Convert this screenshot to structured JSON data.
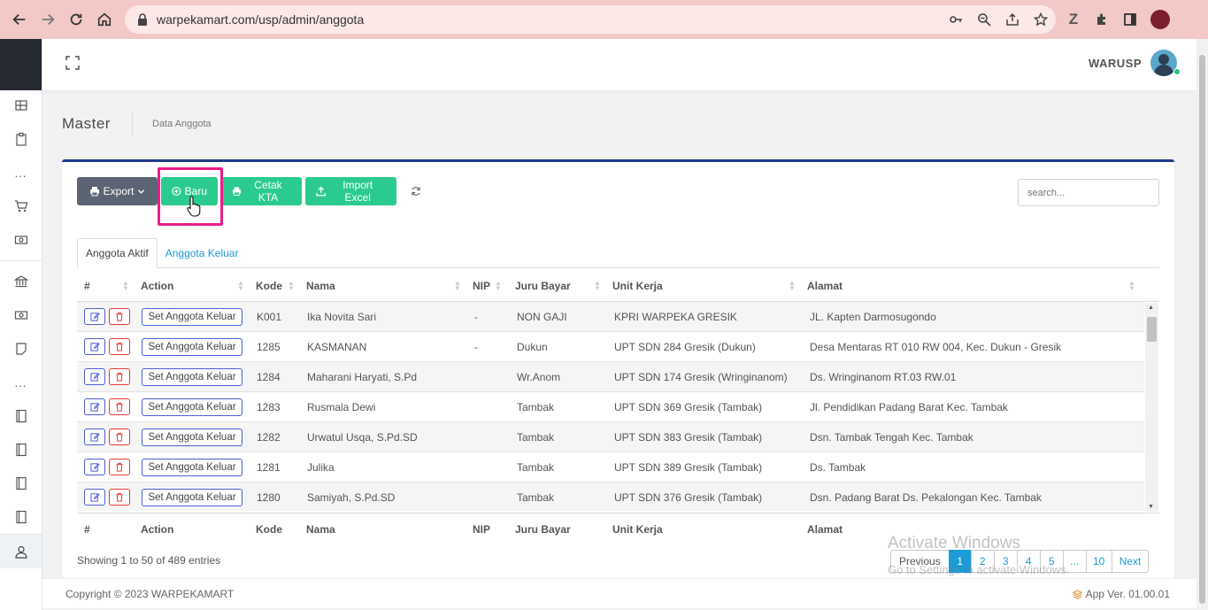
{
  "browser": {
    "url": "warpekamart.com/usp/admin/anggota"
  },
  "topbar": {
    "user_name": "WARUSP"
  },
  "breadcrumb": {
    "title": "Master",
    "current": "Data Anggota"
  },
  "toolbar": {
    "export_label": "Export",
    "baru_label": "Baru",
    "cetak_label": "Cetak KTA",
    "import_label": "Import Excel",
    "search_placeholder": "search..."
  },
  "tabs": [
    {
      "label": "Anggota Aktif",
      "active": true
    },
    {
      "label": "Anggota Keluar",
      "active": false
    }
  ],
  "table": {
    "columns": [
      "#",
      "Action",
      "Kode",
      "Nama",
      "NIP",
      "Juru Bayar",
      "Unit Kerja",
      "Alamat"
    ],
    "action_label": "Set Anggota Keluar",
    "rows": [
      {
        "kode": "K001",
        "nama": "Ika Novita Sari",
        "nip": "-",
        "juru_bayar": "NON GAJI",
        "unit_kerja": "KPRI WARPEKA GRESIK",
        "alamat": "JL. Kapten Darmosugondo"
      },
      {
        "kode": "1285",
        "nama": "KASMANAN",
        "nip": "-",
        "juru_bayar": "Dukun",
        "unit_kerja": "UPT SDN 284 Gresik (Dukun)",
        "alamat": "Desa Mentaras RT 010 RW 004, Kec. Dukun - Gresik"
      },
      {
        "kode": "1284",
        "nama": "Maharani Haryati, S.Pd",
        "nip": "",
        "juru_bayar": "Wr.Anom",
        "unit_kerja": "UPT SDN 174 Gresik (Wringinanom)",
        "alamat": "Ds. Wringinanom RT.03 RW.01"
      },
      {
        "kode": "1283",
        "nama": "Rusmala Dewi",
        "nip": "",
        "juru_bayar": "Tambak",
        "unit_kerja": "UPT SDN 369 Gresik (Tambak)",
        "alamat": "Jl. Pendidikan Padang Barat Kec. Tambak"
      },
      {
        "kode": "1282",
        "nama": "Urwatul Usqa, S.Pd.SD",
        "nip": "",
        "juru_bayar": "Tambak",
        "unit_kerja": "UPT SDN 383 Gresik (Tambak)",
        "alamat": "Dsn. Tambak Tengah Kec. Tambak"
      },
      {
        "kode": "1281",
        "nama": "Julika",
        "nip": "",
        "juru_bayar": "Tambak",
        "unit_kerja": "UPT SDN 389 Gresik (Tambak)",
        "alamat": "Ds. Tambak"
      },
      {
        "kode": "1280",
        "nama": "Samiyah, S.Pd.SD",
        "nip": "",
        "juru_bayar": "Tambak",
        "unit_kerja": "UPT SDN 376 Gresik (Tambak)",
        "alamat": "Dsn. Padang Barat Ds. Pekalongan Kec. Tambak"
      }
    ]
  },
  "info": "Showing 1 to 50 of 489 entries",
  "pagination": {
    "previous": "Previous",
    "pages": [
      "1",
      "2",
      "3",
      "4",
      "5",
      "...",
      "10"
    ],
    "next": "Next"
  },
  "watermark": {
    "line1": "Activate Windows",
    "line2": "Go to Settings to activate Windows."
  },
  "footer": {
    "copyright": "Copyright © 2023 WARPEKAMART",
    "version": "App Ver. 01.00.01"
  },
  "colors": {
    "accent_green": "#2bcb8f",
    "accent_blue": "#1c9bd6",
    "card_top_border": "#1e3a8a",
    "highlight": "#e91e8c"
  }
}
